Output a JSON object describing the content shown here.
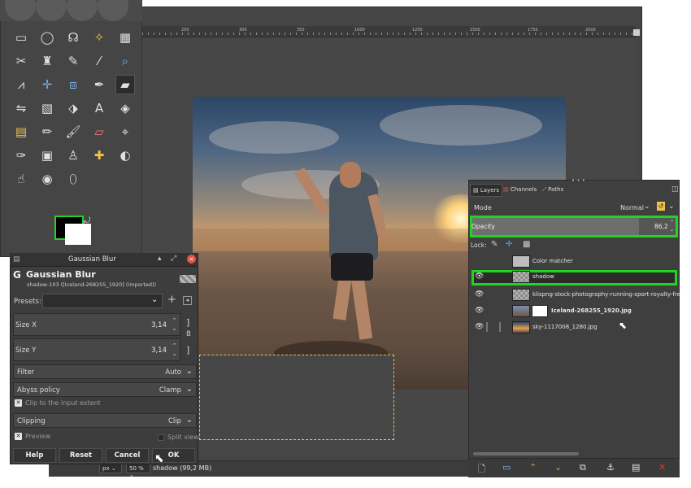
{
  "canvas": {
    "ruler_ticks": [
      "250",
      "300",
      "350",
      "1000",
      "1250",
      "1500",
      "1750",
      "2000"
    ],
    "status": {
      "unit": "px",
      "zoom": "50 %",
      "info": "shadow (99,2 MB)"
    }
  },
  "toolbox": {
    "tools": [
      "rect-select-icon",
      "ellipse-select-icon",
      "free-select-icon",
      "fuzzy-select-icon",
      "color-select-icon",
      "scissors-icon",
      "foreground-select-icon",
      "paths-icon",
      "color-picker-icon",
      "zoom-icon",
      "measure-icon",
      "move-icon",
      "align-icon",
      "transform-icon",
      "perspective-icon",
      "flip-icon",
      "cage-icon",
      "warp-icon",
      "text-icon",
      "unified-transform-icon",
      "gradient-icon",
      "pencil-icon",
      "paintbrush-icon",
      "eraser-icon",
      "airbrush-icon",
      "ink-icon",
      "mypaint-icon",
      "clone-icon",
      "heal-icon",
      "dodge-icon",
      "smudge-icon",
      "blur-icon",
      "bucket-fill-icon"
    ],
    "colors": {
      "foreground": "#000000",
      "background": "#ffffff"
    }
  },
  "blur_dialog": {
    "window_title": "Gaussian Blur",
    "heading": "Gaussian Blur",
    "subtitle": "shadow-103 ([Iceland-268255_1920] (imported))",
    "presets_label": "Presets:",
    "presets_value": "",
    "size_x": {
      "label": "Size X",
      "value": "3,14"
    },
    "size_y": {
      "label": "Size Y",
      "value": "3,14"
    },
    "filter": {
      "label": "Filter",
      "value": "Auto"
    },
    "abyss": {
      "label": "Abyss policy",
      "value": "Clamp"
    },
    "clip_input": {
      "label": "Clip to the input extent",
      "checked": true
    },
    "clipping": {
      "label": "Clipping",
      "value": "Clip"
    },
    "preview": {
      "label": "Preview",
      "checked": true
    },
    "split_view": {
      "label": "Split view",
      "checked": false
    },
    "buttons": {
      "help": "Help",
      "reset": "Reset",
      "cancel": "Cancel",
      "ok": "OK"
    }
  },
  "layers_dock": {
    "tabs": [
      "Layers",
      "Channels",
      "Paths"
    ],
    "mode_label": "Mode",
    "mode_value": "Normal",
    "opacity_label": "Opacity",
    "opacity_value": "86,2",
    "opacity_fraction": 0.862,
    "lock_label": "Lock:",
    "layers": [
      {
        "name": "Color matcher",
        "visible": false,
        "selected": false,
        "bold": false
      },
      {
        "name": "shadow",
        "visible": true,
        "selected": true,
        "bold": false
      },
      {
        "name": "klispng-stock-photography-running-sport-royalty-fre",
        "visible": true,
        "selected": false,
        "bold": false
      },
      {
        "name": "Iceland-268255_1920.jpg",
        "visible": true,
        "selected": false,
        "bold": true
      },
      {
        "name": "sky-1117008_1280.jpg",
        "visible": true,
        "selected": false,
        "bold": false
      }
    ]
  },
  "highlight_color": "#21d421"
}
